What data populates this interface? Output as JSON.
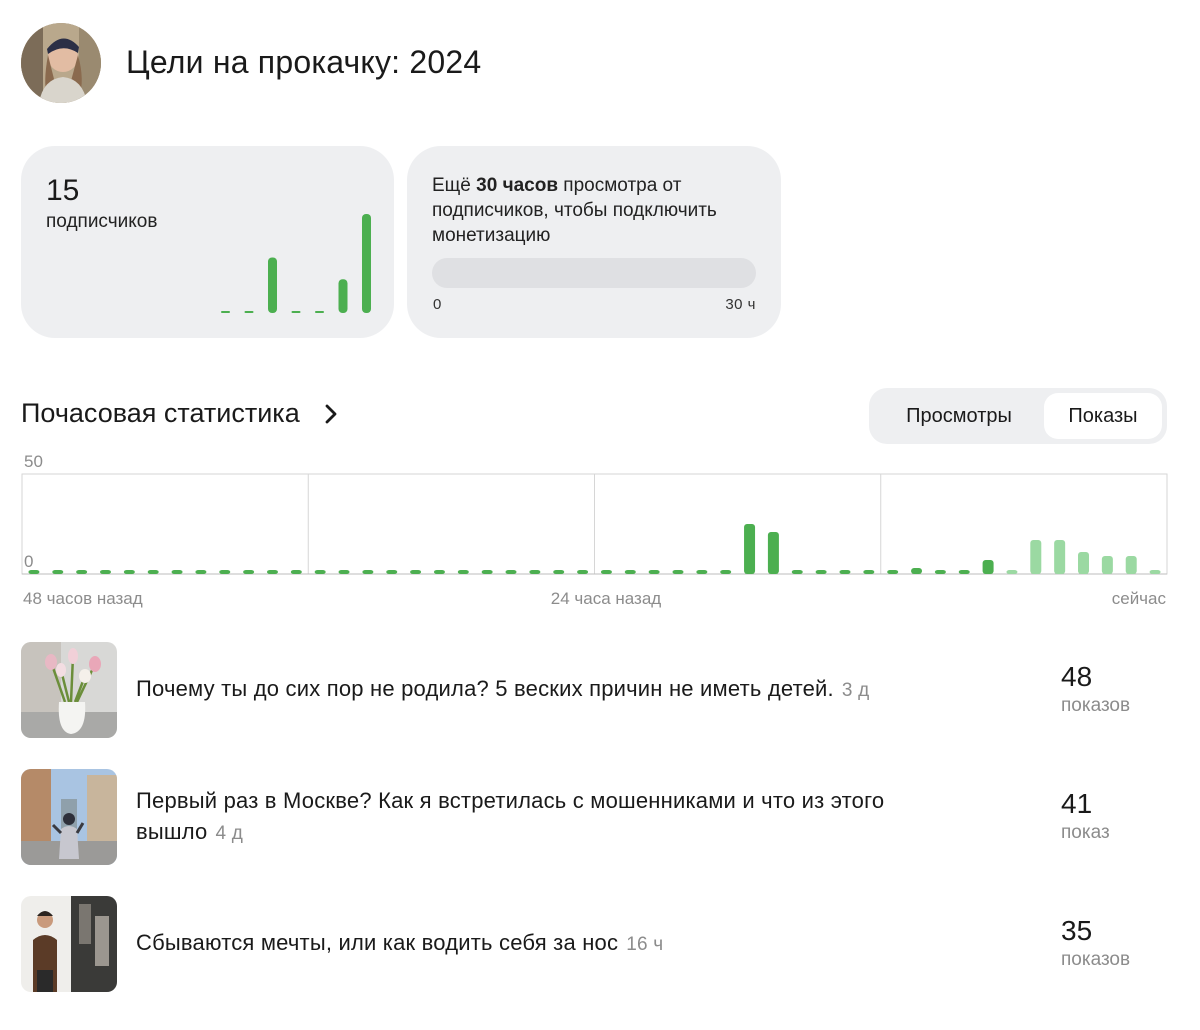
{
  "header": {
    "title": "Цели на прокачку: 2024"
  },
  "subscribers_card": {
    "count": "15",
    "label": "подписчиков",
    "mini_chart": [
      0,
      0,
      23,
      0,
      0,
      14,
      41
    ]
  },
  "monetization_card": {
    "text_prefix": "Ещё ",
    "text_bold": "30 часов",
    "text_suffix": " просмотра от подписчиков, чтобы подключить монетизацию",
    "progress_fraction": 0,
    "min_label": "0",
    "max_label": "30 ч"
  },
  "hourly": {
    "title": "Почасовая статистика",
    "tabs": [
      {
        "label": "Просмотры",
        "active": false
      },
      {
        "label": "Показы",
        "active": true
      }
    ]
  },
  "colors": {
    "accent_green": "#4caf50",
    "light_green": "#9bd9a2",
    "card_bg": "#eeeff1",
    "muted_text": "#8c8c8c"
  },
  "chart_data": {
    "type": "bar",
    "title": "",
    "ylim": [
      0,
      50
    ],
    "y_tick_labels": [
      "50",
      "0"
    ],
    "x_tick_labels": [
      "48 часов назад",
      "24 часа назад",
      "сейчас"
    ],
    "grid": true,
    "series": [
      {
        "values": [
          0,
          0,
          0,
          0,
          0,
          0,
          0,
          0,
          0,
          0,
          0,
          0,
          0,
          0,
          0,
          0,
          0,
          0,
          0,
          0,
          0,
          0,
          0,
          0,
          0,
          0,
          0,
          0,
          0,
          0,
          25,
          21,
          2,
          1,
          1,
          1,
          1,
          3,
          1,
          1,
          7,
          1,
          17,
          17,
          11,
          9,
          9,
          1
        ]
      }
    ],
    "highlight_from_index": 41
  },
  "videos": [
    {
      "title": "Почему ты до сих пор не родила? 5 веских причин не иметь детей.",
      "age": "3 д",
      "count": "48",
      "count_label": "показов",
      "thumb_icon": "tulips-photo-thumbnail"
    },
    {
      "title": "Первый раз в Москве? Как я встретилась с мошенниками и что из этого вышло",
      "age": "4 д",
      "count": "41",
      "count_label": "показ",
      "thumb_icon": "street-photo-thumbnail"
    },
    {
      "title": "Сбываются мечты, или как водить себя за нос",
      "age": "16 ч",
      "count": "35",
      "count_label": "показов",
      "thumb_icon": "portrait-photo-thumbnail"
    }
  ]
}
